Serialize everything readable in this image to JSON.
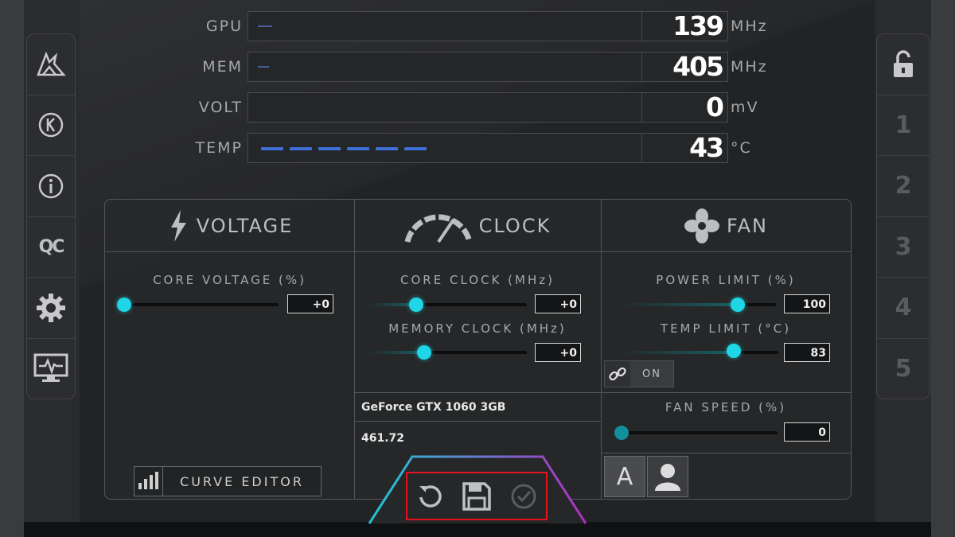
{
  "monitor": {
    "rows": [
      {
        "label": "GPU",
        "value": "139",
        "unit": "MHz"
      },
      {
        "label": "MEM",
        "value": "405",
        "unit": "MHz"
      },
      {
        "label": "VOLT",
        "value": "0",
        "unit": "mV"
      },
      {
        "label": "TEMP",
        "value": "43",
        "unit": "°C"
      }
    ]
  },
  "left_sidebar": {
    "items": [
      {
        "icon": "msi-dragon-logo-icon"
      },
      {
        "icon": "k-circle-icon"
      },
      {
        "icon": "info-icon"
      },
      {
        "icon": "oc-scanner-icon",
        "label": "QC"
      },
      {
        "icon": "gear-icon"
      },
      {
        "icon": "monitor-icon"
      }
    ]
  },
  "right_sidebar": {
    "lock_icon": "lock-open-icon",
    "profiles": [
      "1",
      "2",
      "3",
      "4",
      "5"
    ]
  },
  "sections": {
    "voltage": {
      "title": "VOLTAGE"
    },
    "clock": {
      "title": "CLOCK"
    },
    "fan": {
      "title": "FAN"
    }
  },
  "controls": {
    "core_voltage": {
      "label": "CORE VOLTAGE (%)",
      "value": "+0"
    },
    "core_clock": {
      "label": "CORE CLOCK (MHz)",
      "value": "+0"
    },
    "memory_clock": {
      "label": "MEMORY CLOCK (MHz)",
      "value": "+0"
    },
    "power_limit": {
      "label": "POWER LIMIT (%)",
      "value": "100"
    },
    "temp_limit": {
      "label": "TEMP LIMIT (°C)",
      "value": "83"
    },
    "link": {
      "label": "ON"
    },
    "fan_speed": {
      "label": "FAN SPEED (%)",
      "value": "0"
    },
    "curve_editor": {
      "label": "CURVE EDITOR"
    },
    "fan_auto": {
      "label": "A"
    }
  },
  "gpu_info": {
    "name": "GeForce GTX 1060 3GB",
    "driver": "461.72"
  },
  "actions": {
    "reset_icon": "reset-icon",
    "save_icon": "save-icon",
    "apply_icon": "apply-check-icon",
    "highlight_color": "#e5141c"
  },
  "colors": {
    "accent": "#1fd6e6",
    "temp_bar": "#3f6fd8"
  }
}
